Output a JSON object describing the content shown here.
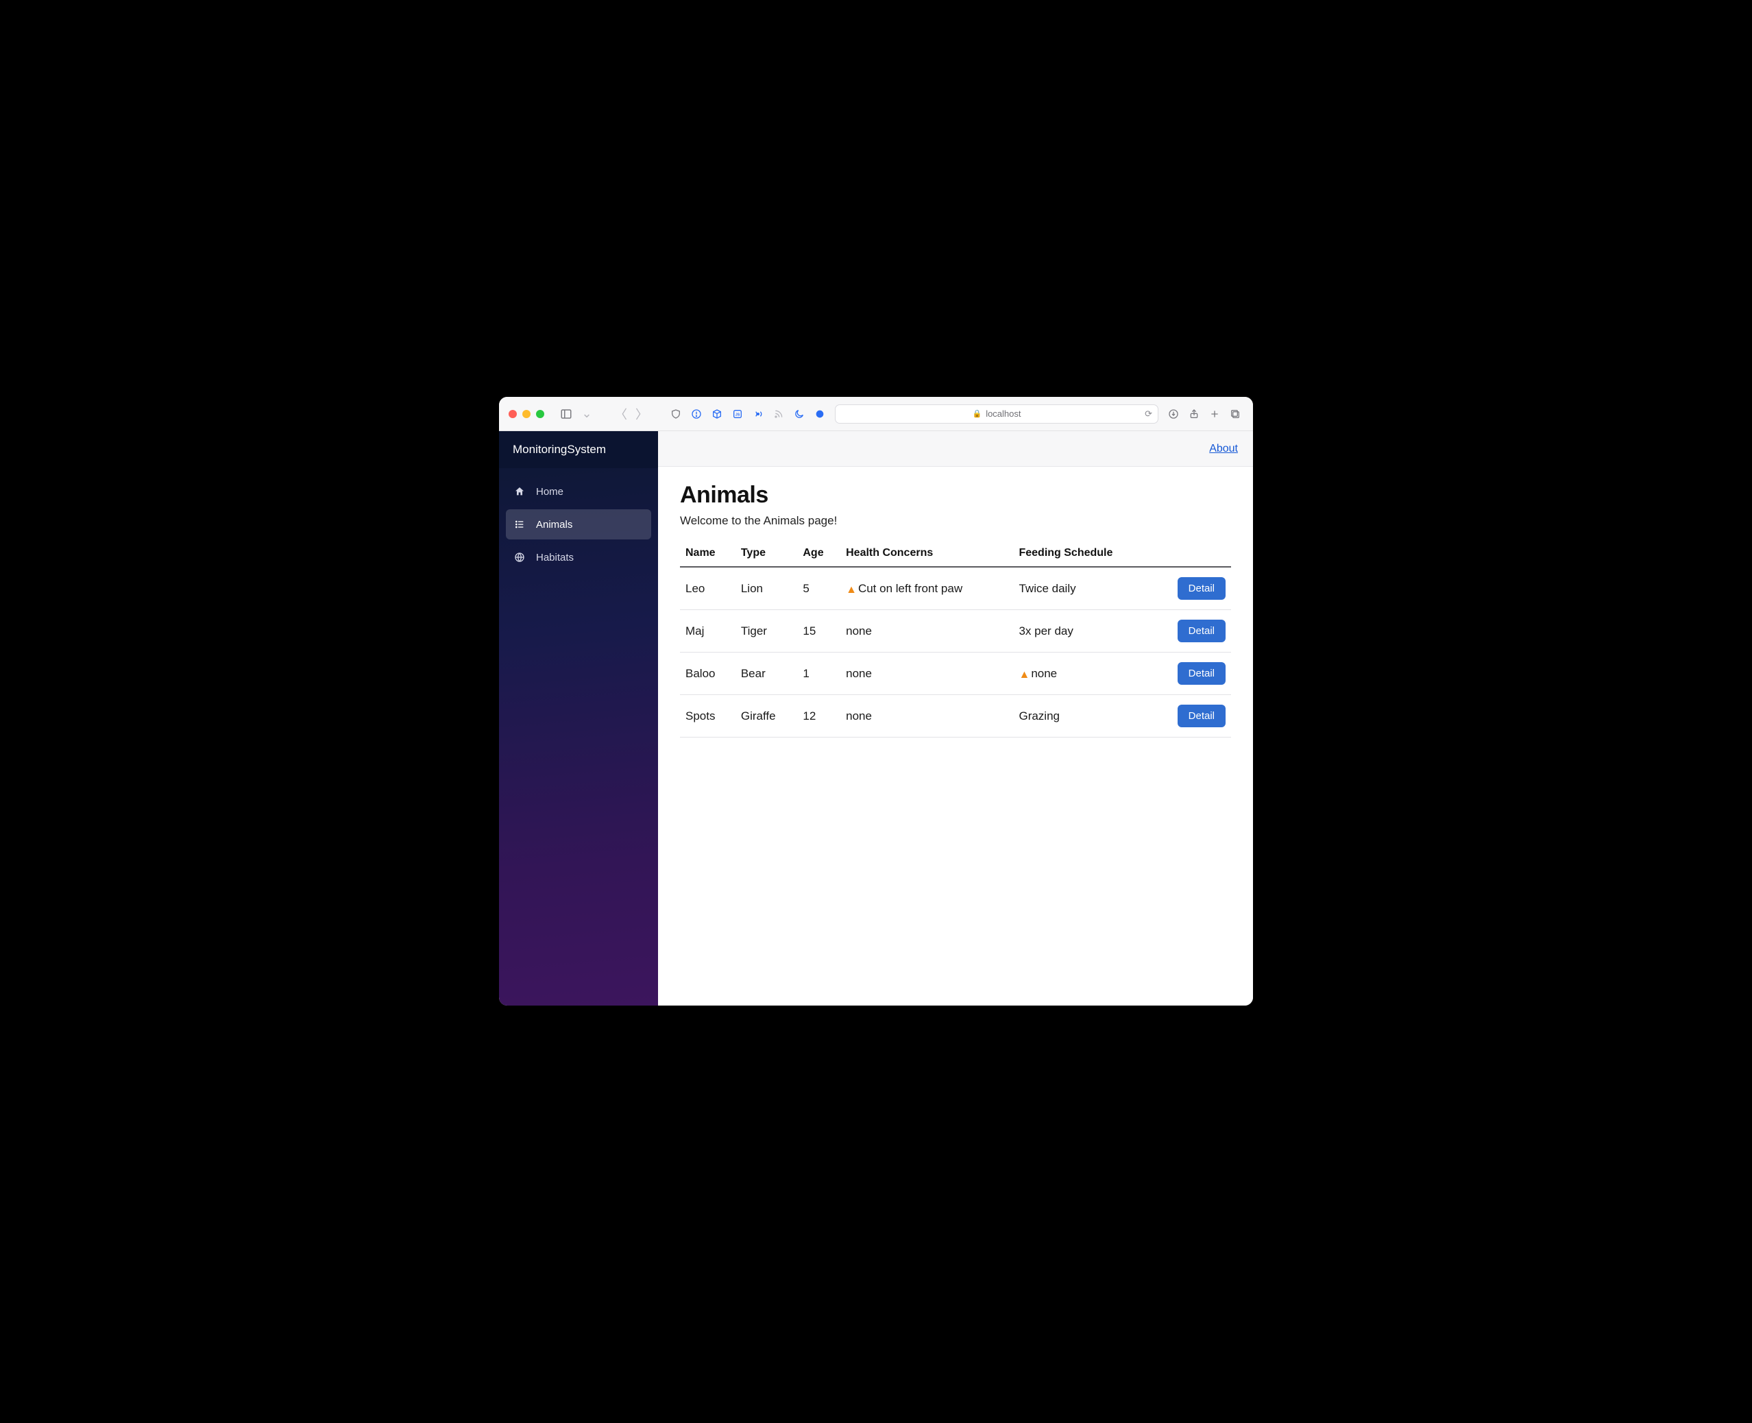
{
  "browser": {
    "address": "localhost"
  },
  "sidebar": {
    "brand": "MonitoringSystem",
    "items": [
      {
        "label": "Home",
        "icon": "home-icon",
        "active": false
      },
      {
        "label": "Animals",
        "icon": "list-icon",
        "active": true
      },
      {
        "label": "Habitats",
        "icon": "globe-icon",
        "active": false
      }
    ]
  },
  "topbar": {
    "about_label": "About"
  },
  "page": {
    "title": "Animals",
    "subtitle": "Welcome to the Animals page!"
  },
  "table": {
    "columns": [
      "Name",
      "Type",
      "Age",
      "Health Concerns",
      "Feeding Schedule"
    ],
    "detail_label": "Detail",
    "rows": [
      {
        "name": "Leo",
        "type": "Lion",
        "age": "5",
        "health": "Cut on left front paw",
        "health_alert": true,
        "feeding": "Twice daily",
        "feeding_alert": false
      },
      {
        "name": "Maj",
        "type": "Tiger",
        "age": "15",
        "health": "none",
        "health_alert": false,
        "feeding": "3x per day",
        "feeding_alert": false
      },
      {
        "name": "Baloo",
        "type": "Bear",
        "age": "1",
        "health": "none",
        "health_alert": false,
        "feeding": "none",
        "feeding_alert": true
      },
      {
        "name": "Spots",
        "type": "Giraffe",
        "age": "12",
        "health": "none",
        "health_alert": false,
        "feeding": "Grazing",
        "feeding_alert": false
      }
    ]
  }
}
